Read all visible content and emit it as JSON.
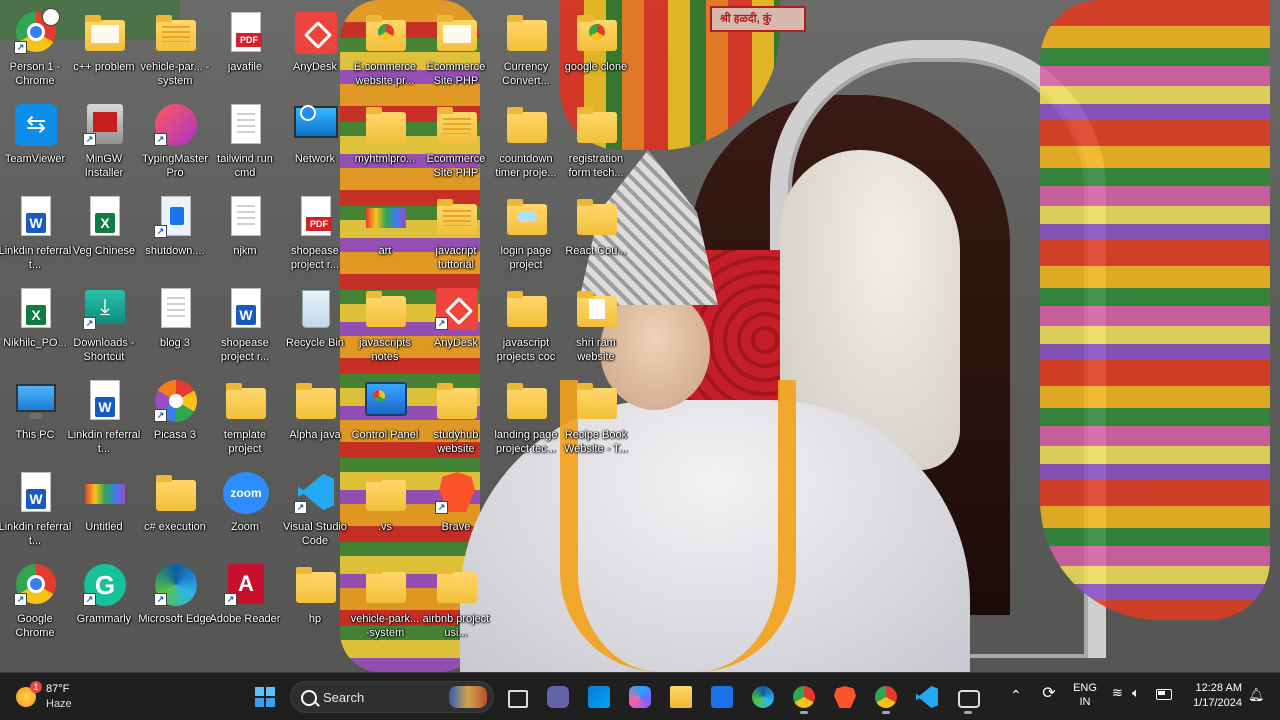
{
  "desktop": {
    "icons": [
      {
        "label": "Person 1 - Chrome"
      },
      {
        "label": "c++ problem"
      },
      {
        "label": "vehicle-par... -system"
      },
      {
        "label": "javafile"
      },
      {
        "label": "AnyDesk"
      },
      {
        "label": "E-commerce website pr..."
      },
      {
        "label": "Ecommerce Site PHP"
      },
      {
        "label": "Currency Convert..."
      },
      {
        "label": "google clone"
      },
      {
        "label": "TeamViewer"
      },
      {
        "label": "MinGW Installer"
      },
      {
        "label": "TypingMaster Pro"
      },
      {
        "label": "tailwind run cmd"
      },
      {
        "label": "Network"
      },
      {
        "label": "myhtmlpro..."
      },
      {
        "label": "Ecommerce Site PHP"
      },
      {
        "label": "countdown timer proje..."
      },
      {
        "label": "registration form tech..."
      },
      {
        "label": "Linkdin referral t..."
      },
      {
        "label": "Veg Chinese"
      },
      {
        "label": "shutdown...."
      },
      {
        "label": "njkm"
      },
      {
        "label": "shopease project r..."
      },
      {
        "label": "art"
      },
      {
        "label": "javacript tuttorial"
      },
      {
        "label": "login page project"
      },
      {
        "label": "React Cou..."
      },
      {
        "label": "Nikhilc_PO..."
      },
      {
        "label": "Downloads - Shortcut"
      },
      {
        "label": "blog 3"
      },
      {
        "label": "shopease project r..."
      },
      {
        "label": "Recycle Bin"
      },
      {
        "label": "javascripts notes"
      },
      {
        "label": "AnyDesk"
      },
      {
        "label": "javascript projects coc"
      },
      {
        "label": "shri ram website"
      },
      {
        "label": "This PC"
      },
      {
        "label": "Linkdin referral t..."
      },
      {
        "label": "Picasa 3"
      },
      {
        "label": "template project"
      },
      {
        "label": "Alpha java"
      },
      {
        "label": "Control Panel"
      },
      {
        "label": "studyhub website"
      },
      {
        "label": "landing page project tec..."
      },
      {
        "label": "Recipe Book Website - T..."
      },
      {
        "label": "Linkdin referral t..."
      },
      {
        "label": "Untitled"
      },
      {
        "label": "c# execution"
      },
      {
        "label": "Zoom"
      },
      {
        "label": "Visual Studio Code"
      },
      {
        "label": ".vs"
      },
      {
        "label": "Brave"
      },
      {
        "label": "Google Chrome"
      },
      {
        "label": "Grammarly"
      },
      {
        "label": "Microsoft Edge"
      },
      {
        "label": "Adobe Reader"
      },
      {
        "label": "hp"
      },
      {
        "label": "vehicle-park... -system"
      },
      {
        "label": "airbnb project usi..."
      }
    ],
    "wallpaper_sign": "श्री हळदी, कुं"
  },
  "taskbar": {
    "weather": {
      "temp": "87°F",
      "condition": "Haze",
      "badge": "1"
    },
    "search": {
      "placeholder": "Search"
    },
    "tray": {
      "language": "ENG",
      "region": "IN",
      "time": "12:28 AM",
      "date": "1/17/2024"
    }
  }
}
